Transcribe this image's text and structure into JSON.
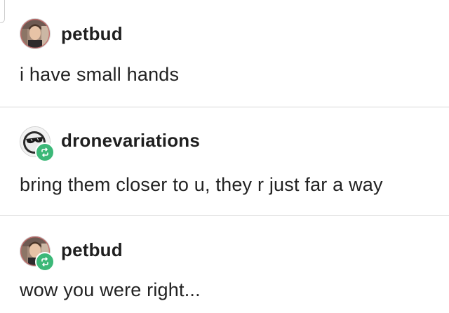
{
  "posts": [
    {
      "username": "petbud",
      "text": "i have small hands",
      "avatar": "petbud-avatar",
      "reblogged": false
    },
    {
      "username": "dronevariations",
      "text": "bring them closer to u, they r just far a way",
      "avatar": "sunglasses-avatar",
      "reblogged": true
    },
    {
      "username": "petbud",
      "text": "wow you were right...",
      "avatar": "petbud-avatar",
      "reblogged": true
    }
  ],
  "colors": {
    "reblog_badge": "#3cb878",
    "divider": "#d6d6d6",
    "text": "#222222"
  },
  "icons": {
    "reblog": "reblog-icon"
  }
}
